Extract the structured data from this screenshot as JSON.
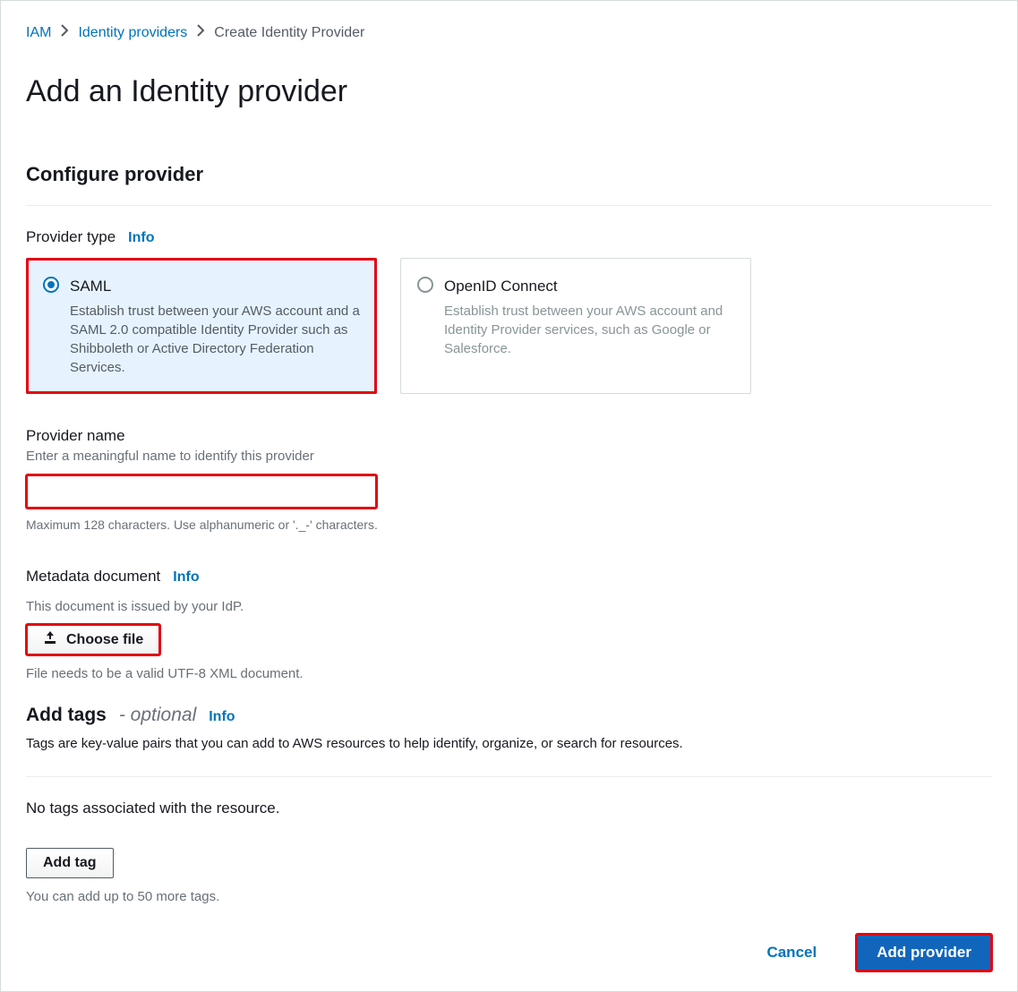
{
  "breadcrumb": {
    "items": [
      "IAM",
      "Identity providers"
    ],
    "current": "Create Identity Provider"
  },
  "page_title": "Add an Identity provider",
  "configure": {
    "heading": "Configure provider",
    "provider_type_label": "Provider type",
    "info_label": "Info",
    "options": {
      "saml": {
        "title": "SAML",
        "desc": "Establish trust between your AWS account and a SAML 2.0 compatible Identity Provider such as Shibboleth or Active Directory Federation Services."
      },
      "oidc": {
        "title": "OpenID Connect",
        "desc": "Establish trust between your AWS account and Identity Provider services, such as Google or Salesforce."
      }
    }
  },
  "provider_name": {
    "label": "Provider name",
    "desc": "Enter a meaningful name to identify this provider",
    "value": "",
    "helper": "Maximum 128 characters. Use alphanumeric or '._-' characters."
  },
  "metadata": {
    "label": "Metadata document",
    "info_label": "Info",
    "desc": "This document is issued by your IdP.",
    "choose_file_label": "Choose file",
    "helper": "File needs to be a valid UTF-8 XML document."
  },
  "tags": {
    "title": "Add tags",
    "optional_label": "- optional",
    "info_label": "Info",
    "desc": "Tags are key-value pairs that you can add to AWS resources to help identify, organize, or search for resources.",
    "no_tags_text": "No tags associated with the resource.",
    "add_tag_label": "Add tag",
    "helper": "You can add up to 50 more tags."
  },
  "footer": {
    "cancel_label": "Cancel",
    "add_provider_label": "Add provider"
  }
}
